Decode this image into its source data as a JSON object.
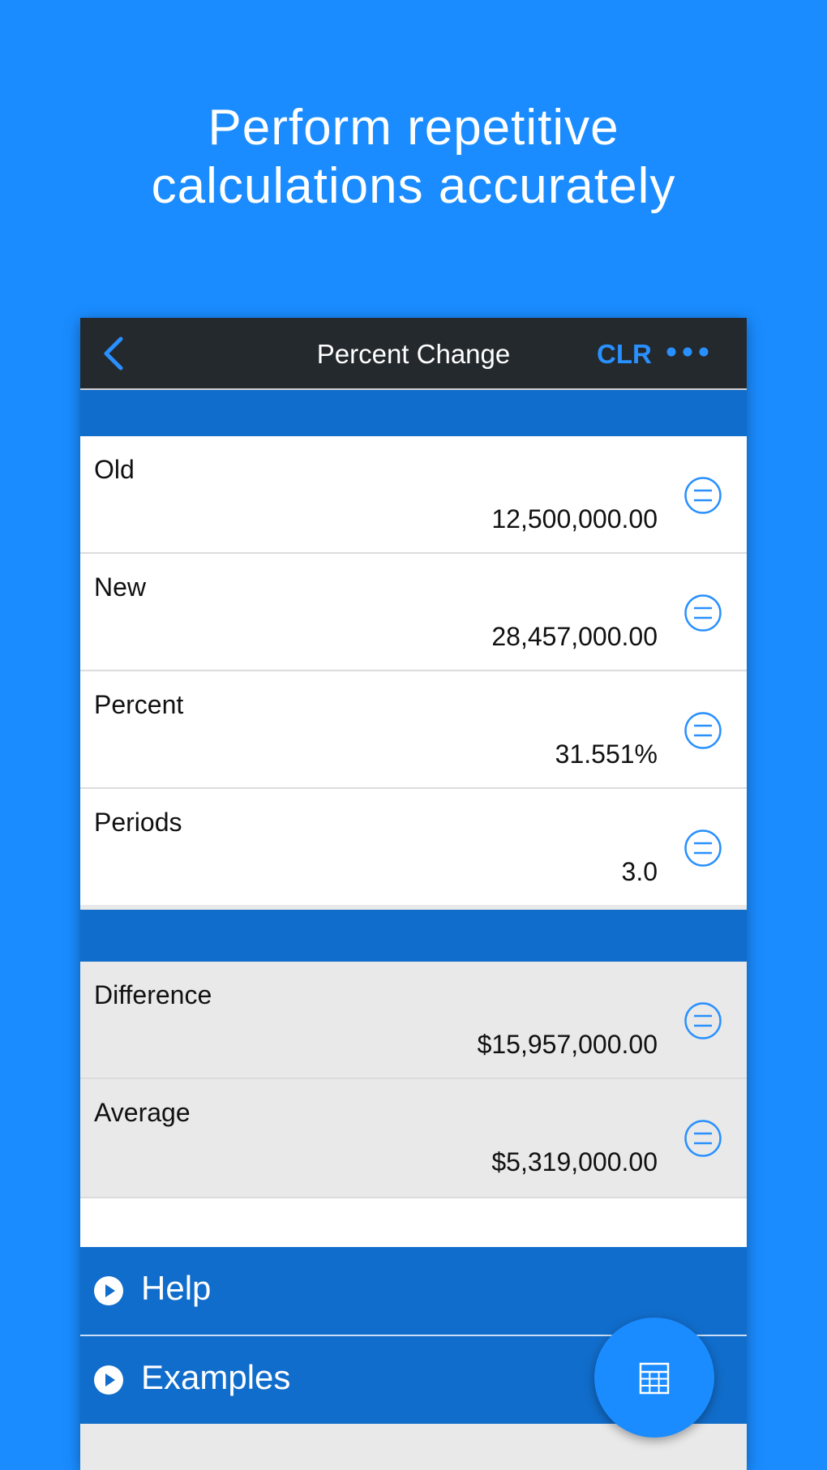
{
  "headline": {
    "line1": "Perform repetitive",
    "line2": "calculations accurately"
  },
  "navbar": {
    "title": "Percent Change",
    "clear_label": "CLR",
    "back_icon": "chevron-left-icon",
    "more_icon": "more-dots-icon"
  },
  "inputs": [
    {
      "label": "Old",
      "value": "12,500,000.00"
    },
    {
      "label": "New",
      "value": "28,457,000.00"
    },
    {
      "label": "Percent",
      "value": "31.551%"
    },
    {
      "label": "Periods",
      "value": "3.0"
    }
  ],
  "outputs": [
    {
      "label": "Difference",
      "value": "$15,957,000.00"
    },
    {
      "label": "Average",
      "value": "$5,319,000.00"
    }
  ],
  "links": {
    "help": "Help",
    "examples": "Examples"
  },
  "colors": {
    "background": "#1a8cff",
    "navbar": "#24292e",
    "section_band": "#116dcb",
    "accent": "#2990ff"
  },
  "fab_icon": "calculator-icon"
}
